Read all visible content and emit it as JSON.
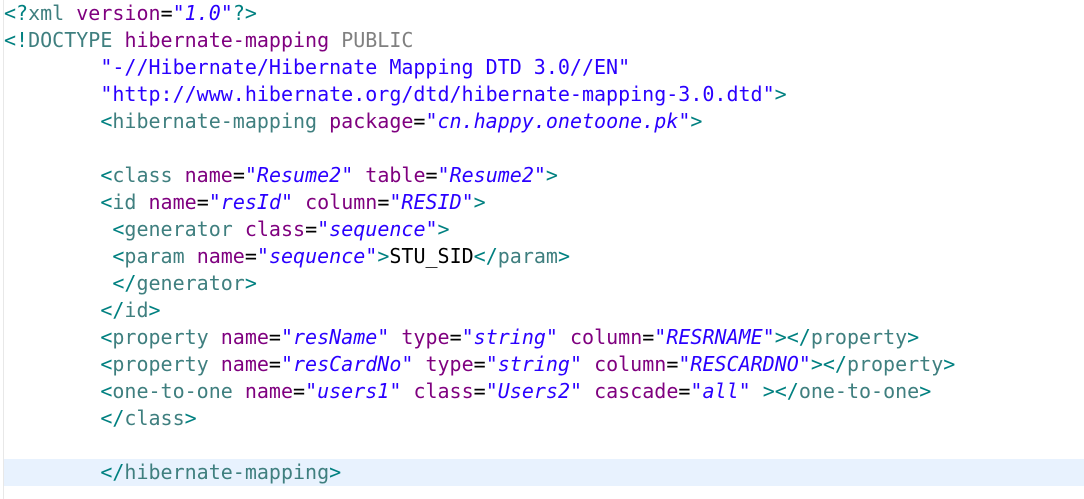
{
  "editor": {
    "lines": [
      [
        {
          "c": "mark",
          "t": "<?"
        },
        {
          "c": "tag",
          "t": "xml"
        },
        {
          "c": "gap",
          "t": " "
        },
        {
          "c": "attr",
          "t": "version"
        },
        {
          "c": "txt",
          "t": "="
        },
        {
          "c": "str",
          "t": "\"1.0\""
        },
        {
          "c": "mark",
          "t": "?>"
        }
      ],
      [
        {
          "c": "mark",
          "t": "<!"
        },
        {
          "c": "tag",
          "t": "DOCTYPE"
        },
        {
          "c": "gap",
          "t": " "
        },
        {
          "c": "attr",
          "t": "hibernate-mapping"
        },
        {
          "c": "gap",
          "t": " "
        },
        {
          "c": "kw",
          "t": "PUBLIC"
        }
      ],
      [
        {
          "c": "gap",
          "t": "        "
        },
        {
          "c": "dtd",
          "t": "\"-//Hibernate/Hibernate Mapping DTD 3.0//EN\""
        }
      ],
      [
        {
          "c": "gap",
          "t": "        "
        },
        {
          "c": "dtd",
          "t": "\"http://www.hibernate.org/dtd/hibernate-mapping-3.0.dtd\""
        },
        {
          "c": "mark",
          "t": ">"
        }
      ],
      [
        {
          "c": "gap",
          "t": "        "
        },
        {
          "c": "mark",
          "t": "<"
        },
        {
          "c": "tag",
          "t": "hibernate-mapping"
        },
        {
          "c": "gap",
          "t": " "
        },
        {
          "c": "attr",
          "t": "package"
        },
        {
          "c": "txt",
          "t": "="
        },
        {
          "c": "str",
          "t": "\"cn.happy.onetoone.pk\""
        },
        {
          "c": "mark",
          "t": ">"
        }
      ],
      [],
      [
        {
          "c": "gap",
          "t": "        "
        },
        {
          "c": "mark",
          "t": "<"
        },
        {
          "c": "tag",
          "t": "class"
        },
        {
          "c": "gap",
          "t": " "
        },
        {
          "c": "attr",
          "t": "name"
        },
        {
          "c": "txt",
          "t": "="
        },
        {
          "c": "str",
          "t": "\"Resume2\""
        },
        {
          "c": "gap",
          "t": " "
        },
        {
          "c": "attr",
          "t": "table"
        },
        {
          "c": "txt",
          "t": "="
        },
        {
          "c": "str",
          "t": "\"Resume2\""
        },
        {
          "c": "mark",
          "t": ">"
        }
      ],
      [
        {
          "c": "gap",
          "t": "        "
        },
        {
          "c": "mark",
          "t": "<"
        },
        {
          "c": "tag",
          "t": "id"
        },
        {
          "c": "gap",
          "t": " "
        },
        {
          "c": "attr",
          "t": "name"
        },
        {
          "c": "txt",
          "t": "="
        },
        {
          "c": "str",
          "t": "\"resId\""
        },
        {
          "c": "gap",
          "t": " "
        },
        {
          "c": "attr",
          "t": "column"
        },
        {
          "c": "txt",
          "t": "="
        },
        {
          "c": "str",
          "t": "\"RESID\""
        },
        {
          "c": "mark",
          "t": ">"
        }
      ],
      [
        {
          "c": "gap",
          "t": "         "
        },
        {
          "c": "mark",
          "t": "<"
        },
        {
          "c": "tag",
          "t": "generator"
        },
        {
          "c": "gap",
          "t": " "
        },
        {
          "c": "attr",
          "t": "class"
        },
        {
          "c": "txt",
          "t": "="
        },
        {
          "c": "str",
          "t": "\"sequence\""
        },
        {
          "c": "mark",
          "t": ">"
        }
      ],
      [
        {
          "c": "gap",
          "t": "         "
        },
        {
          "c": "mark",
          "t": "<"
        },
        {
          "c": "tag",
          "t": "param"
        },
        {
          "c": "gap",
          "t": " "
        },
        {
          "c": "attr",
          "t": "name"
        },
        {
          "c": "txt",
          "t": "="
        },
        {
          "c": "str",
          "t": "\"sequence\""
        },
        {
          "c": "mark",
          "t": ">"
        },
        {
          "c": "txt",
          "t": "STU_SID"
        },
        {
          "c": "mark",
          "t": "</"
        },
        {
          "c": "tag",
          "t": "param"
        },
        {
          "c": "mark",
          "t": ">"
        }
      ],
      [
        {
          "c": "gap",
          "t": "         "
        },
        {
          "c": "mark",
          "t": "</"
        },
        {
          "c": "tag",
          "t": "generator"
        },
        {
          "c": "mark",
          "t": ">"
        }
      ],
      [
        {
          "c": "gap",
          "t": "        "
        },
        {
          "c": "mark",
          "t": "</"
        },
        {
          "c": "tag",
          "t": "id"
        },
        {
          "c": "mark",
          "t": ">"
        }
      ],
      [
        {
          "c": "gap",
          "t": "        "
        },
        {
          "c": "mark",
          "t": "<"
        },
        {
          "c": "tag",
          "t": "property"
        },
        {
          "c": "gap",
          "t": " "
        },
        {
          "c": "attr",
          "t": "name"
        },
        {
          "c": "txt",
          "t": "="
        },
        {
          "c": "str",
          "t": "\"resName\""
        },
        {
          "c": "gap",
          "t": " "
        },
        {
          "c": "attr",
          "t": "type"
        },
        {
          "c": "txt",
          "t": "="
        },
        {
          "c": "str",
          "t": "\"string\""
        },
        {
          "c": "gap",
          "t": " "
        },
        {
          "c": "attr",
          "t": "column"
        },
        {
          "c": "txt",
          "t": "="
        },
        {
          "c": "str",
          "t": "\"RESRNAME\""
        },
        {
          "c": "mark",
          "t": "></"
        },
        {
          "c": "tag",
          "t": "property"
        },
        {
          "c": "mark",
          "t": ">"
        }
      ],
      [
        {
          "c": "gap",
          "t": "        "
        },
        {
          "c": "mark",
          "t": "<"
        },
        {
          "c": "tag",
          "t": "property"
        },
        {
          "c": "gap",
          "t": " "
        },
        {
          "c": "attr",
          "t": "name"
        },
        {
          "c": "txt",
          "t": "="
        },
        {
          "c": "str",
          "t": "\"resCardNo\""
        },
        {
          "c": "gap",
          "t": " "
        },
        {
          "c": "attr",
          "t": "type"
        },
        {
          "c": "txt",
          "t": "="
        },
        {
          "c": "str",
          "t": "\"string\""
        },
        {
          "c": "gap",
          "t": " "
        },
        {
          "c": "attr",
          "t": "column"
        },
        {
          "c": "txt",
          "t": "="
        },
        {
          "c": "str",
          "t": "\"RESCARDNO\""
        },
        {
          "c": "mark",
          "t": "></"
        },
        {
          "c": "tag",
          "t": "property"
        },
        {
          "c": "mark",
          "t": ">"
        }
      ],
      [
        {
          "c": "gap",
          "t": "        "
        },
        {
          "c": "mark",
          "t": "<"
        },
        {
          "c": "tag",
          "t": "one-to-one"
        },
        {
          "c": "gap",
          "t": " "
        },
        {
          "c": "attr",
          "t": "name"
        },
        {
          "c": "txt",
          "t": "="
        },
        {
          "c": "str",
          "t": "\"users1\""
        },
        {
          "c": "gap",
          "t": " "
        },
        {
          "c": "attr",
          "t": "class"
        },
        {
          "c": "txt",
          "t": "="
        },
        {
          "c": "str",
          "t": "\"Users2\""
        },
        {
          "c": "gap",
          "t": " "
        },
        {
          "c": "attr",
          "t": "cascade"
        },
        {
          "c": "txt",
          "t": "="
        },
        {
          "c": "str",
          "t": "\"all\""
        },
        {
          "c": "gap",
          "t": " "
        },
        {
          "c": "mark",
          "t": "></"
        },
        {
          "c": "tag",
          "t": "one-to-one"
        },
        {
          "c": "mark",
          "t": ">"
        }
      ],
      [
        {
          "c": "gap",
          "t": "        "
        },
        {
          "c": "mark",
          "t": "</"
        },
        {
          "c": "tag",
          "t": "class"
        },
        {
          "c": "mark",
          "t": ">"
        }
      ],
      [],
      [
        {
          "c": "gap",
          "t": "        "
        },
        {
          "c": "mark",
          "t": "</"
        },
        {
          "c": "tag",
          "t": "hibernate-mapping"
        },
        {
          "c": "mark",
          "t": ">"
        }
      ]
    ],
    "current_line": 17
  }
}
